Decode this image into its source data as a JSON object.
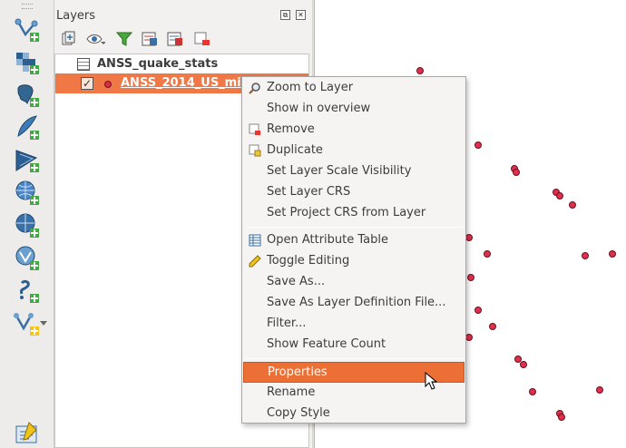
{
  "left_toolbar": {
    "tools": [
      {
        "icon": "add-vector-layer-icon"
      },
      {
        "icon": "add-raster-layer-icon"
      },
      {
        "icon": "add-postgis-layer-icon"
      },
      {
        "icon": "add-spatialite-layer-icon"
      },
      {
        "icon": "add-mssql-layer-icon"
      },
      {
        "icon": "add-wms-layer-icon"
      },
      {
        "icon": "add-wcs-layer-icon"
      },
      {
        "icon": "add-wfs-layer-icon"
      },
      {
        "icon": "add-delimited-text-layer-icon"
      },
      {
        "icon": "new-shapefile-layer-icon"
      }
    ],
    "bottom_tool": {
      "icon": "python-console-icon"
    }
  },
  "layers_panel": {
    "title": "Layers",
    "toolbar_icons": [
      "add-group-icon",
      "manage-visibility-icon",
      "filter-legend-icon",
      "expand-all-icon",
      "collapse-all-icon",
      "remove-layer-icon"
    ],
    "layers": [
      {
        "name": "ANSS_quake_stats",
        "type": "table",
        "selected": false
      },
      {
        "name": "ANSS_2014_US_mi",
        "type": "point",
        "selected": true,
        "checked": true
      }
    ]
  },
  "context_menu": {
    "groups": [
      [
        {
          "label": "Zoom to Layer",
          "icon": "zoom-to-layer-icon"
        },
        {
          "label": "Show in overview",
          "icon": ""
        },
        {
          "label": "Remove",
          "icon": "remove-layer-icon"
        },
        {
          "label": "Duplicate",
          "icon": "duplicate-layer-icon"
        },
        {
          "label": "Set Layer Scale Visibility",
          "icon": ""
        },
        {
          "label": "Set Layer CRS",
          "icon": ""
        },
        {
          "label": "Set Project CRS from Layer",
          "icon": ""
        }
      ],
      [
        {
          "label": "Open Attribute Table",
          "icon": "attribute-table-icon"
        },
        {
          "label": "Toggle Editing",
          "icon": "pencil-icon"
        },
        {
          "label": "Save As...",
          "icon": ""
        },
        {
          "label": "Save As Layer Definition File...",
          "icon": ""
        },
        {
          "label": "Filter...",
          "icon": ""
        },
        {
          "label": "Show Feature Count",
          "icon": ""
        }
      ],
      [
        {
          "label": "Properties",
          "icon": "",
          "active": true
        },
        {
          "label": "Rename",
          "icon": ""
        },
        {
          "label": "Copy Style",
          "icon": ""
        }
      ]
    ]
  },
  "colors": {
    "selection": "#f07746",
    "menu_active": "#ec6f35",
    "point_fill": "#e0304d"
  }
}
